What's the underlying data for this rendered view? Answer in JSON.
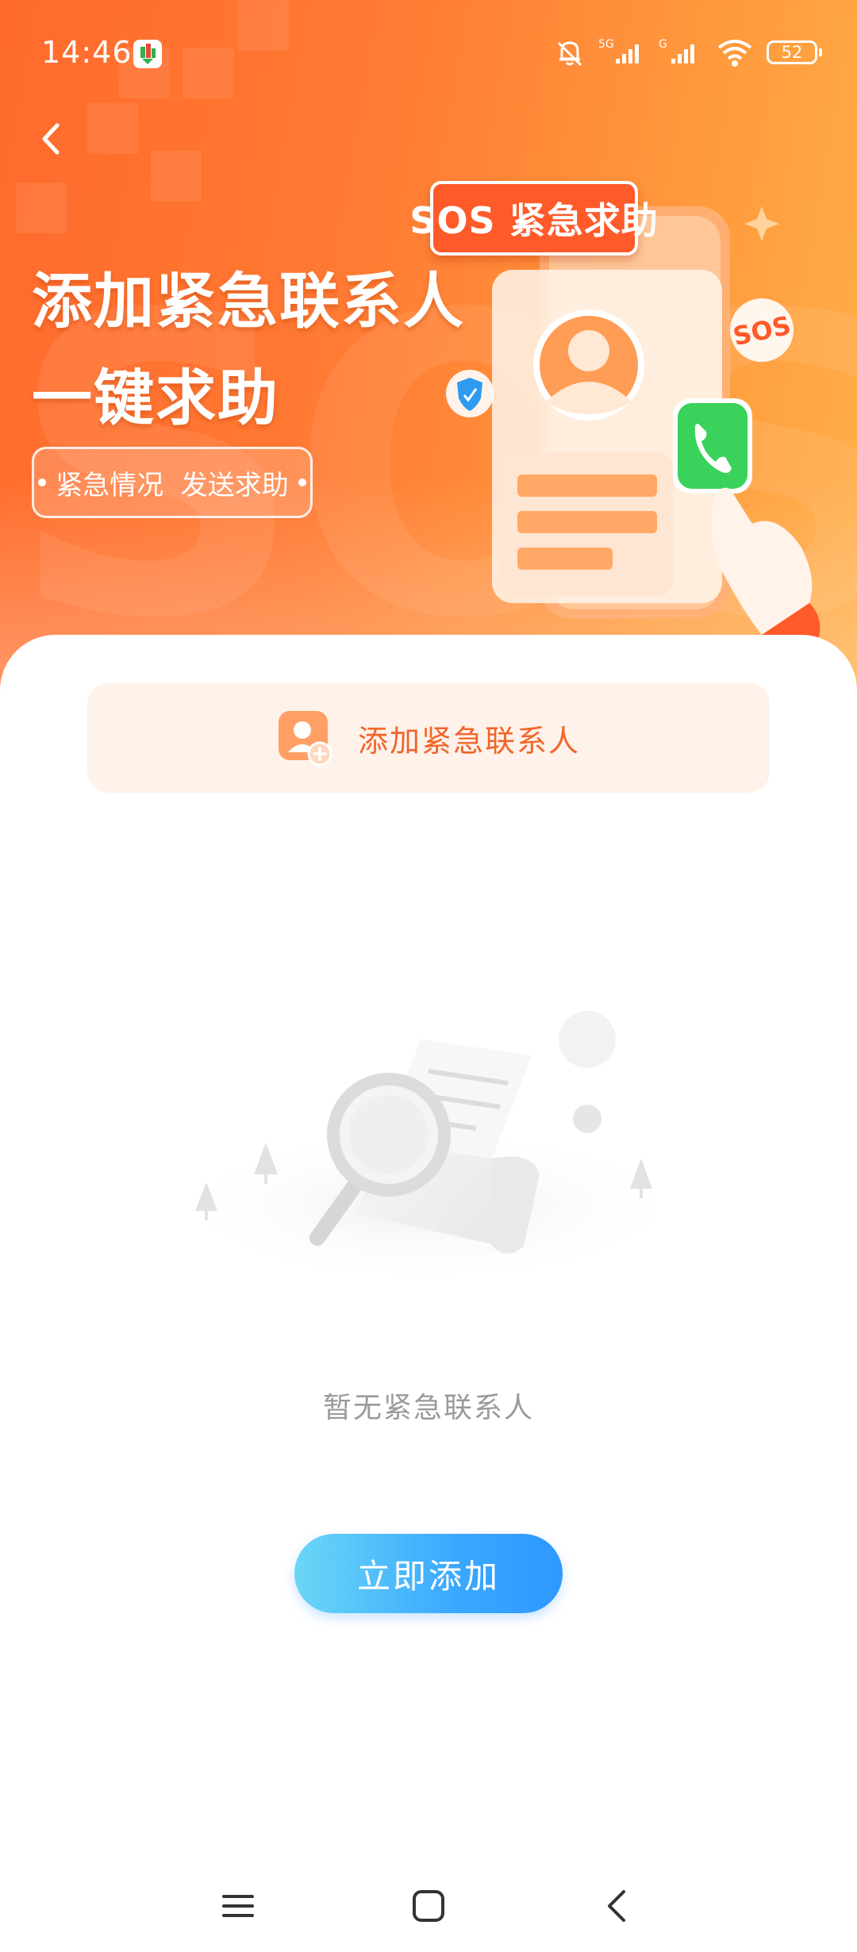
{
  "status_bar": {
    "time": "14:46",
    "battery": "52",
    "icons": [
      "app-notification-icon",
      "mute-bell-icon",
      "signal-5g-icon",
      "signal-g-icon",
      "wifi-icon",
      "battery-icon"
    ]
  },
  "header": {
    "back_icon": "back-arrow-icon"
  },
  "hero": {
    "title_line1": "添加紧急联系人",
    "title_line2": "一键求助",
    "pill_text": "紧急情况  发送求助",
    "sos_banner": "SOS 紧急求助",
    "sos_badge": "SOS"
  },
  "main": {
    "add_contact_label": "添加紧急联系人",
    "add_contact_icon": "add-contact-icon",
    "empty_text": "暂无紧急联系人",
    "add_now_button": "立即添加"
  },
  "nav_bar": {
    "icons": [
      "menu-icon",
      "home-icon",
      "back-icon"
    ]
  },
  "colors": {
    "hero_orange": "#ff7a33",
    "accent_orange": "#f2652a",
    "button_blue": "#2e98ff"
  }
}
